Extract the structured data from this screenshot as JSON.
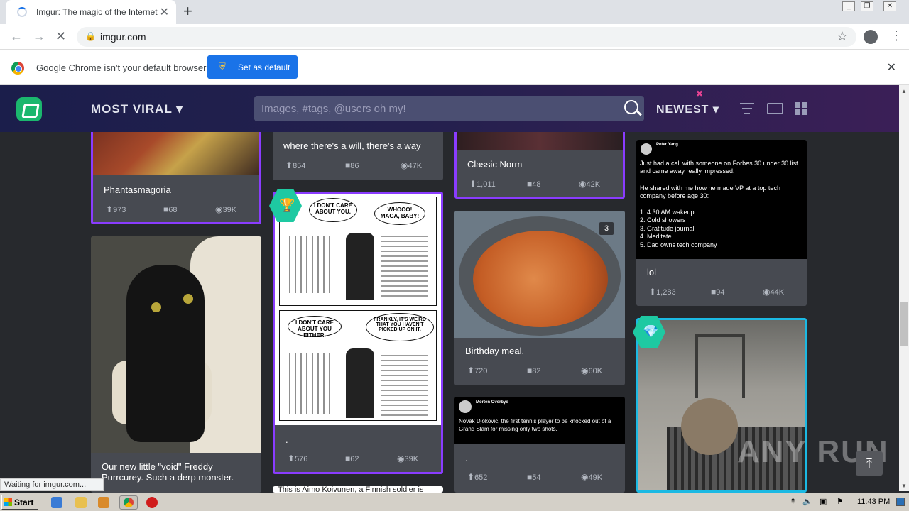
{
  "browser": {
    "tab_title": "Imgur: The magic of the Internet",
    "url": "imgur.com",
    "infobar_message": "Google Chrome isn't your default browser",
    "set_default_label": "Set as default",
    "status_text": "Waiting for imgur.com..."
  },
  "header": {
    "section": "MOST VIRAL",
    "search_placeholder": "Images, #tags, @users oh my!",
    "sort": "NEWEST"
  },
  "posts": [
    {
      "title": "Phantasmagoria",
      "upvotes": "973",
      "comments": "68",
      "views": "39K"
    },
    {
      "title": "where there's a will, there's a way",
      "upvotes": "854",
      "comments": "86",
      "views": "47K"
    },
    {
      "title": "Classic Norm",
      "upvotes": "1,011",
      "comments": "48",
      "views": "42K"
    },
    {
      "title": "lol",
      "upvotes": "1,283",
      "comments": "94",
      "views": "44K"
    },
    {
      "title": "Our new little \"void\" Freddy Purrcurey. Such a derp monster.",
      "upvotes": "",
      "comments": "",
      "views": ""
    },
    {
      "title": ".",
      "upvotes": "576",
      "comments": "62",
      "views": "39K"
    },
    {
      "title": "Birthday meal.",
      "upvotes": "720",
      "comments": "82",
      "views": "60K",
      "count": "3"
    },
    {
      "title": ".",
      "upvotes": "652",
      "comments": "54",
      "views": "49K"
    },
    {
      "title": "This is Aimo Koivunen, a Finnish soldier is"
    }
  ],
  "tweets": {
    "peter": {
      "name": "Peter Yang",
      "lines": [
        "Just had a call with someone on Forbes 30 under 30 list and came away really impressed.",
        "He shared with me how he made VP at a top tech company before age 30:",
        "1. 4:30 AM wakeup",
        "2. Cold showers",
        "3. Gratitude journal",
        "4. Meditate",
        "5. Dad owns tech company"
      ]
    },
    "morten": {
      "name": "Morten Overbye",
      "text": "Novak Djokovic, the first tennis player to be knocked out of a Grand Slam for missing only two shots."
    }
  },
  "comic": {
    "panel1_left": "I DON'T CARE ABOUT YOU.",
    "panel1_right": "WHOOO! MAGA, BABY!",
    "panel2_left": "I DON'T CARE ABOUT YOU EITHER.",
    "panel2_right": "FRANKLY, IT'S WEIRD THAT YOU HAVEN'T PICKED UP ON IT."
  },
  "taskbar": {
    "start": "Start",
    "clock": "11:43 PM"
  },
  "watermark": "ANY RUN"
}
